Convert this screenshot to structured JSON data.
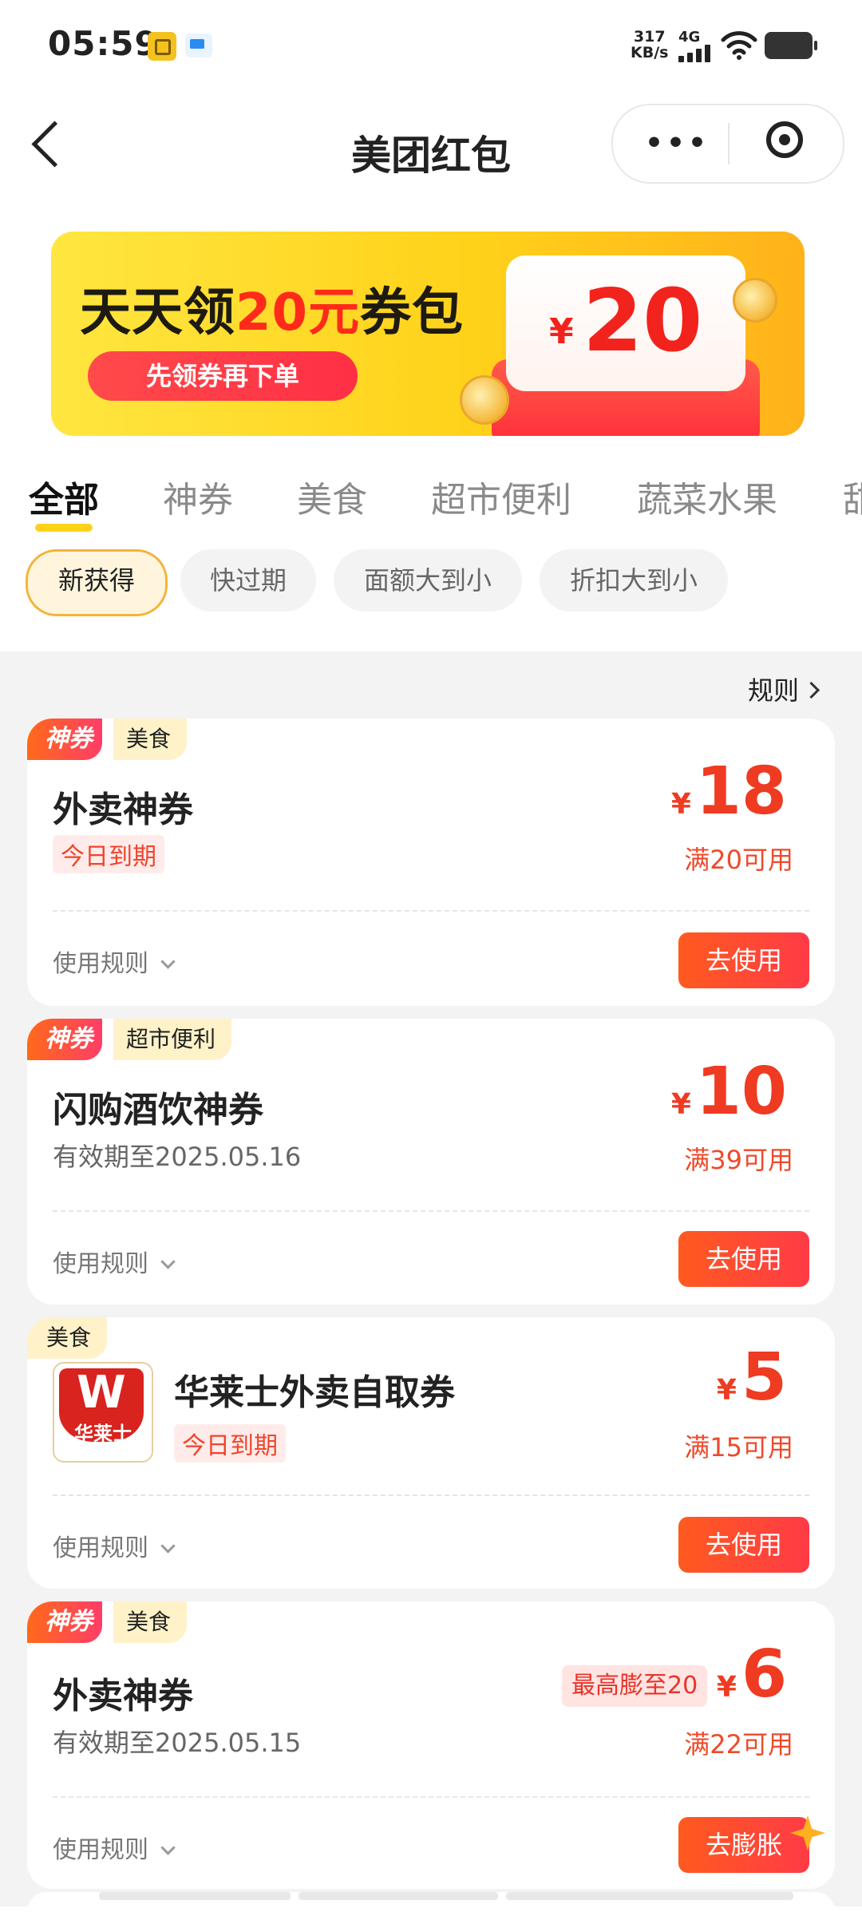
{
  "status_bar": {
    "time": "05:59",
    "net_speed_value": "317",
    "net_speed_unit": "KB/s",
    "network": "4G"
  },
  "nav": {
    "title": "美团红包"
  },
  "banner": {
    "title_prefix": "天天领",
    "title_highlight": "20元",
    "title_suffix": "券包",
    "pill": "先领券再下单",
    "currency": "¥",
    "amount": "20"
  },
  "tabs": [
    "全部",
    "神券",
    "美食",
    "超市便利",
    "蔬菜水果",
    "甜"
  ],
  "filters": [
    "新获得",
    "快过期",
    "面额大到小",
    "折扣大到小"
  ],
  "rules_link": "规则",
  "coupons": [
    {
      "god_badge": "神券",
      "category": "美食",
      "title": "外卖神券",
      "tag": "今日到期",
      "currency": "¥",
      "amount": "18",
      "condition": "满20可用",
      "rules": "使用规则",
      "button": "去使用"
    },
    {
      "god_badge": "神券",
      "category": "超市便利",
      "title": "闪购酒饮神券",
      "date": "有效期至2025.05.16",
      "currency": "¥",
      "amount": "10",
      "condition": "满39可用",
      "rules": "使用规则",
      "button": "去使用"
    },
    {
      "category": "美食",
      "logo_text": "华莱士",
      "title": "华莱士外卖自取券",
      "tag": "今日到期",
      "currency": "¥",
      "amount": "5",
      "condition": "满15可用",
      "rules": "使用规则",
      "button": "去使用"
    },
    {
      "god_badge": "神券",
      "category": "美食",
      "title": "外卖神券",
      "date": "有效期至2025.05.15",
      "boost": "最高膨至20",
      "currency": "¥",
      "amount": "6",
      "condition": "满22可用",
      "rules": "使用规则",
      "button": "去膨胀"
    }
  ]
}
